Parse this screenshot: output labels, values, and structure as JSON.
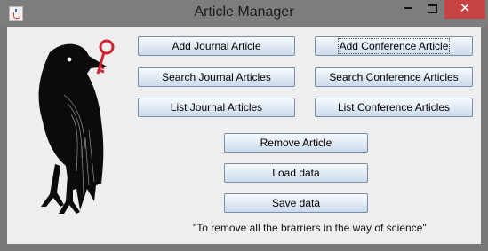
{
  "window": {
    "title": "Article Manager",
    "controls": {
      "minimize": "",
      "maximize": "",
      "close": "✕"
    },
    "accent_close": "#c74242"
  },
  "buttons": {
    "add_journal": "Add Journal Article",
    "add_conference": "Add Conference Article",
    "search_journal": "Search Journal Articles",
    "search_conference": "Search Conference Articles",
    "list_journal": "List Journal Articles",
    "list_conference": "List Conference Articles",
    "remove": "Remove Article",
    "load": "Load data",
    "save": "Save data"
  },
  "quote": "\"To remove all the brarriers in the way of science\"",
  "logo": {
    "icon": "crow-with-key-icon"
  }
}
